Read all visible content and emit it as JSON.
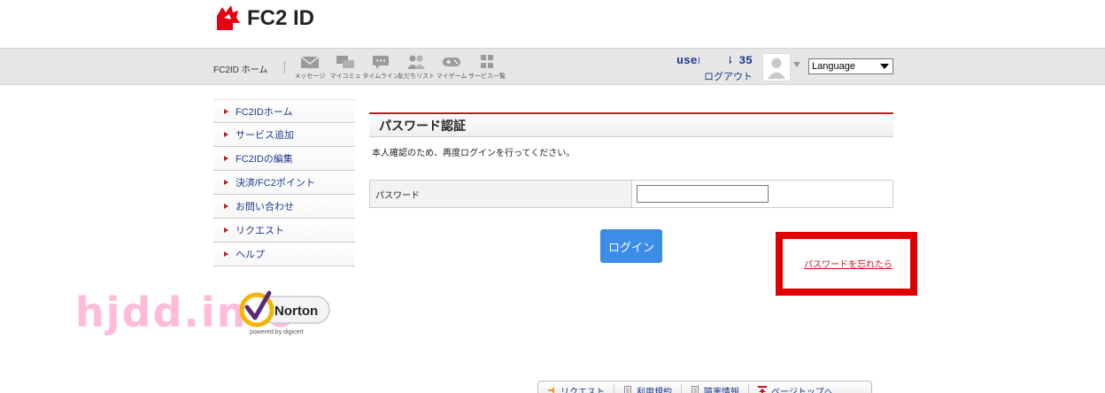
{
  "header": {
    "logo_text": "FC2 ID"
  },
  "navbar": {
    "home_label": "FC2ID ホーム",
    "icons": [
      {
        "label": "メッセージ",
        "icon": "mail-icon"
      },
      {
        "label": "マイコミュ",
        "icon": "chat-icon"
      },
      {
        "label": "タイムライン",
        "icon": "comment-icon"
      },
      {
        "label": "友だちリスト",
        "icon": "friends-icon"
      },
      {
        "label": "マイゲーム",
        "icon": "gamepad-icon"
      },
      {
        "label": "サービス一覧",
        "icon": "grid-icon"
      }
    ],
    "username": "user1604    35",
    "logout": "ログアウト",
    "language": "Language"
  },
  "sidebar": {
    "items": [
      {
        "label": "FC2IDホーム"
      },
      {
        "label": "サービス追加"
      },
      {
        "label": "FC2IDの編集"
      },
      {
        "label": "決済/FC2ポイント"
      },
      {
        "label": "お問い合わせ"
      },
      {
        "label": "リクエスト"
      },
      {
        "label": "ヘルプ"
      }
    ]
  },
  "badge": {
    "name": "Norton",
    "sub": "powered by digicert"
  },
  "watermark": "hjdd.info",
  "main": {
    "title": "パスワード認証",
    "description": "本人確認のため、再度ログインを行ってください。",
    "password_label": "パスワード",
    "password_value": "",
    "login_button": "ログイン",
    "forgot_link": "パスワードを忘れたら"
  },
  "footer": {
    "items": [
      {
        "label": "リクエスト",
        "icon": "request-icon"
      },
      {
        "label": "利用規約",
        "icon": "document-icon"
      },
      {
        "label": "障害情報",
        "icon": "document-icon"
      },
      {
        "label": "ページトップへ",
        "icon": "page-top-icon"
      }
    ]
  },
  "colors": {
    "accent_red": "#c4161c",
    "link_blue": "#1b3a8c",
    "button_blue": "#3b8de6",
    "highlight_red": "#e00000"
  }
}
